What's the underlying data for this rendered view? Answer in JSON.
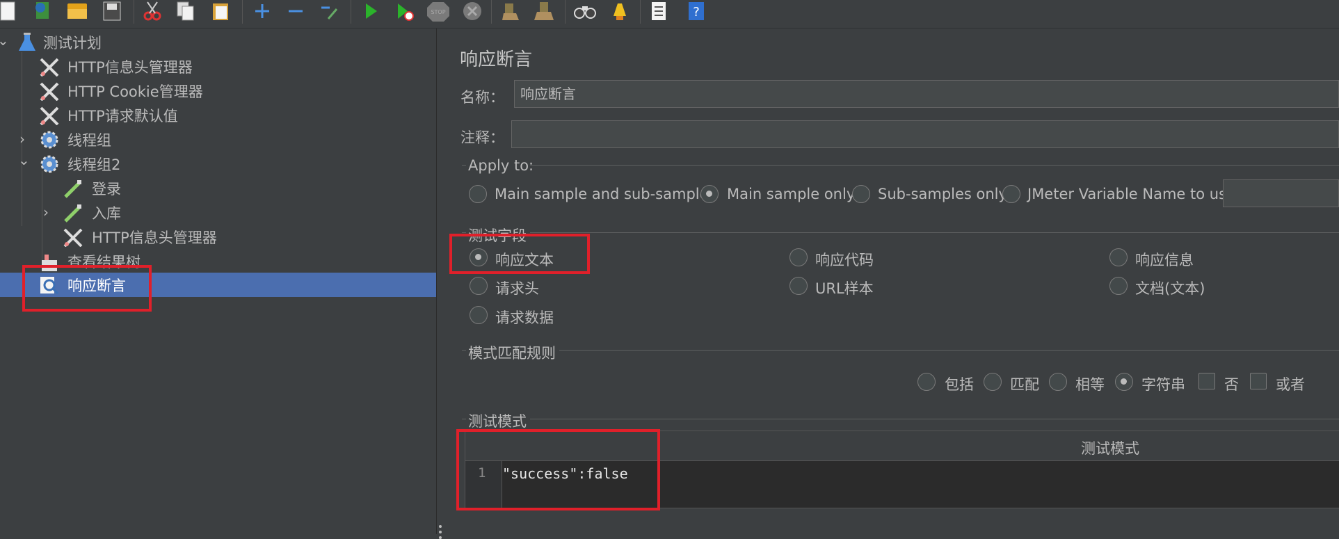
{
  "toolbar": {
    "buttons": [
      "new-icon",
      "templates-icon",
      "open-icon",
      "save-icon",
      "cut-icon",
      "copy-icon",
      "paste-icon",
      "expand-icon",
      "collapse-icon",
      "toggle-icon",
      "start-icon",
      "start-no-pause-icon",
      "stop-icon",
      "shutdown-icon",
      "clear-icon",
      "clear-all-icon",
      "search-icon",
      "reset-search-icon",
      "function-helper-icon",
      "help-icon"
    ],
    "stop_label": "STOP"
  },
  "tree": {
    "items": [
      {
        "label": "测试计划",
        "icon": "flask-icon"
      },
      {
        "label": "HTTP信息头管理器",
        "icon": "wrench-icon"
      },
      {
        "label": "HTTP Cookie管理器",
        "icon": "wrench-icon"
      },
      {
        "label": "HTTP请求默认值",
        "icon": "wrench-icon"
      },
      {
        "label": "线程组",
        "icon": "gear-icon"
      },
      {
        "label": "线程组2",
        "icon": "gear-icon"
      },
      {
        "label": "登录",
        "icon": "pipette-icon"
      },
      {
        "label": "入库",
        "icon": "pipette-icon"
      },
      {
        "label": "HTTP信息头管理器",
        "icon": "wrench-icon"
      },
      {
        "label": "查看结果树",
        "icon": "chart-icon"
      },
      {
        "label": "响应断言",
        "icon": "magnifier-icon"
      }
    ]
  },
  "panel": {
    "title": "响应断言",
    "name_label": "名称：",
    "name_value": "响应断言",
    "comment_label": "注释：",
    "comment_value": "",
    "apply_to": {
      "legend": "Apply to:",
      "options": [
        "Main sample and sub-samples",
        "Main sample only",
        "Sub-samples only",
        "JMeter Variable Name to use"
      ],
      "selected": "Main sample only",
      "variable_value": ""
    },
    "test_field": {
      "legend": "测试字段",
      "options": [
        "响应文本",
        "响应代码",
        "响应信息",
        "请求头",
        "URL样本",
        "文档(文本)",
        "请求数据"
      ],
      "selected": "响应文本"
    },
    "pattern_rules": {
      "legend": "模式匹配规则",
      "radios": [
        "包括",
        "匹配",
        "相等",
        "字符串"
      ],
      "selected": "字符串",
      "checkboxes": [
        "否",
        "或者"
      ]
    },
    "patterns": {
      "legend": "测试模式",
      "column_header": "测试模式",
      "rows": [
        {
          "line": "1",
          "text": "\"success\":false"
        }
      ]
    }
  }
}
